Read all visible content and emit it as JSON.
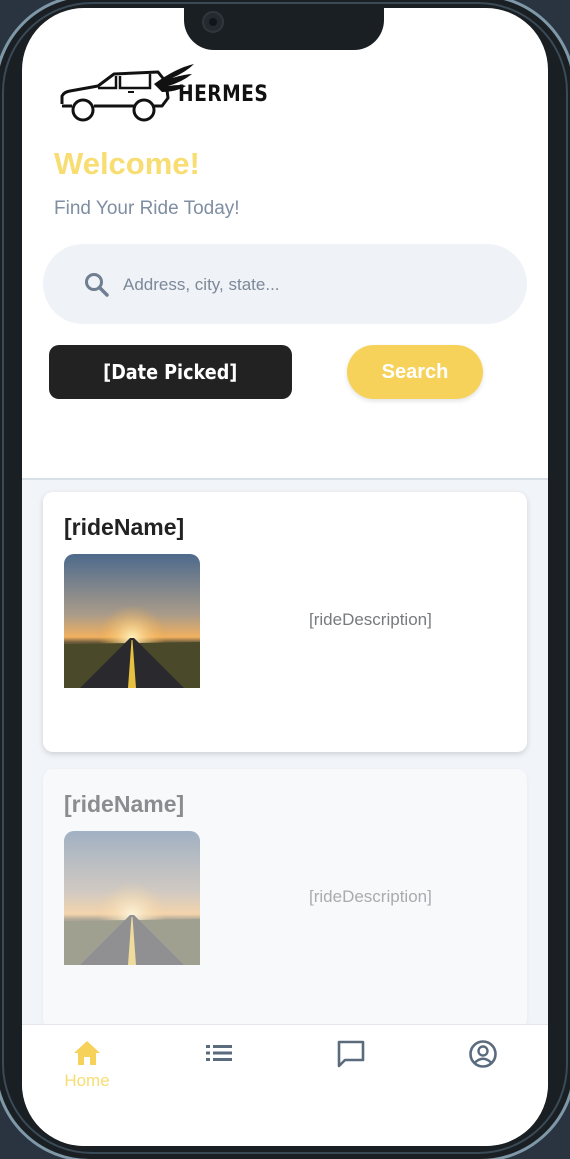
{
  "app": {
    "logo_icon": "car-with-wings-icon",
    "brand_name": "HERMES"
  },
  "header": {
    "welcome": "Welcome!",
    "tagline": "Find Your Ride Today!"
  },
  "search": {
    "icon": "search-icon",
    "placeholder": "Address, city, state...",
    "value": ""
  },
  "actions": {
    "date_label": "[Date Picked]",
    "search_label": "Search"
  },
  "rides": [
    {
      "name": "[rideName]",
      "description": "[rideDescription]",
      "image": "sunset-road-photo"
    },
    {
      "name": "[rideName]",
      "description": "[rideDescription]",
      "image": "sunset-road-photo"
    }
  ],
  "nav": {
    "items": [
      {
        "icon": "home-icon",
        "label": "Home",
        "active": true
      },
      {
        "icon": "list-icon",
        "label": "",
        "active": false
      },
      {
        "icon": "chat-icon",
        "label": "",
        "active": false
      },
      {
        "icon": "profile-icon",
        "label": "",
        "active": false
      }
    ]
  },
  "colors": {
    "accent": "#f7dd72",
    "button_yellow": "#f7d25a",
    "dark_button": "#222222",
    "muted_text": "#7f8ea2",
    "inactive_icon": "#5a6b7d"
  }
}
